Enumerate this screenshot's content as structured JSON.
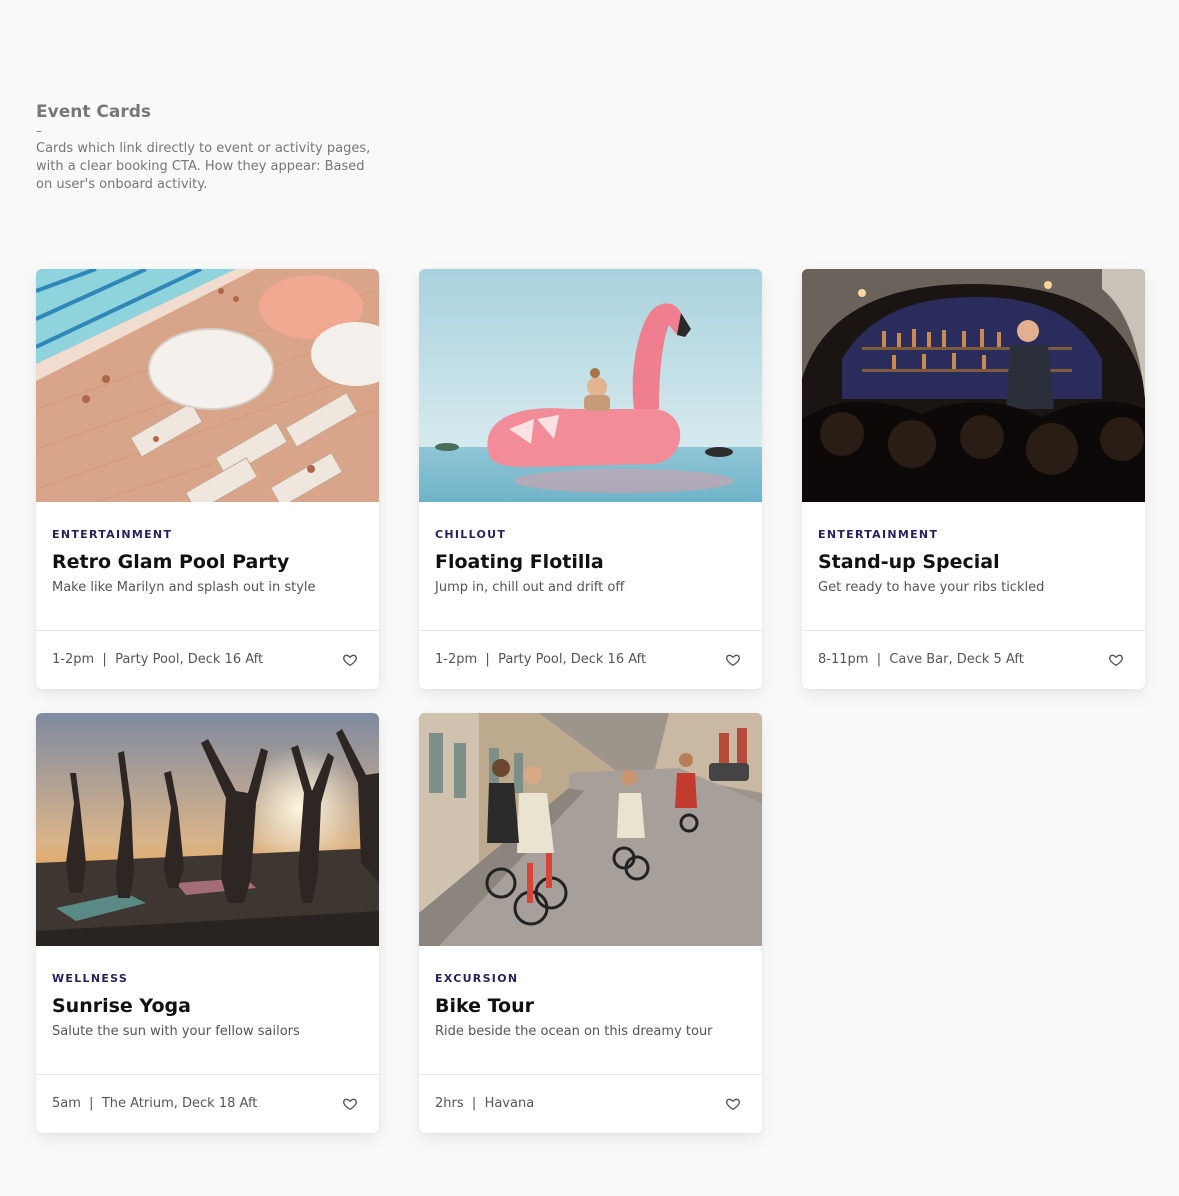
{
  "intro": {
    "title": "Event Cards",
    "dash": "–",
    "description": "Cards which link directly to event or activity pages, with a clear booking CTA. How they appear: Based on user's onboard activity."
  },
  "cards": [
    {
      "category": "ENTERTAINMENT",
      "title": "Retro Glam Pool Party",
      "description": "Make like Marilyn and splash out in style",
      "time": "1-2pm",
      "separator": "|",
      "location": "Party Pool, Deck 16 Aft",
      "icon": "heart-outline-icon"
    },
    {
      "category": "CHILLOUT",
      "title": "Floating Flotilla",
      "description": "Jump in, chill out and drift off",
      "time": "1-2pm",
      "separator": "|",
      "location": "Party Pool, Deck 16 Aft",
      "icon": "heart-outline-icon"
    },
    {
      "category": "ENTERTAINMENT",
      "title": "Stand-up Special",
      "description": "Get ready to have your ribs tickled",
      "time": "8-11pm",
      "separator": "|",
      "location": "Cave Bar, Deck 5 Aft",
      "icon": "heart-outline-icon"
    },
    {
      "category": "WELLNESS",
      "title": "Sunrise Yoga",
      "description": "Salute the sun with your fellow sailors",
      "time": "5am",
      "separator": "|",
      "location": "The Atrium, Deck 18 Aft",
      "icon": "heart-outline-icon"
    },
    {
      "category": "EXCURSION",
      "title": "Bike Tour",
      "description": "Ride beside the ocean on this dreamy tour",
      "time": "2hrs",
      "separator": "|",
      "location": "Havana",
      "icon": "heart-outline-icon"
    }
  ],
  "colors": {
    "background": "#f9f9f9",
    "category": "#2a1f5c",
    "title": "#111111",
    "muted": "#555555"
  }
}
